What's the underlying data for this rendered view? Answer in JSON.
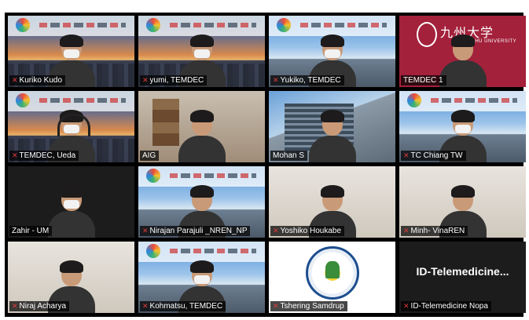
{
  "participants": [
    {
      "name": "Kuriko Kudo",
      "muted": true,
      "bg": "city",
      "banner": true
    },
    {
      "name": "yumi, TEMDEC",
      "muted": true,
      "bg": "city",
      "banner": true
    },
    {
      "name": "Yukiko, TEMDEC",
      "muted": true,
      "bg": "day",
      "banner": true
    },
    {
      "name": "TEMDEC 1",
      "muted": false,
      "bg": "kyushu",
      "banner": false
    },
    {
      "name": "TEMDEC, Ueda",
      "muted": true,
      "bg": "city",
      "banner": true
    },
    {
      "name": "AIG",
      "muted": false,
      "bg": "room",
      "banner": false,
      "active": true
    },
    {
      "name": "Mohan S",
      "muted": false,
      "bg": "bldg",
      "banner": false
    },
    {
      "name": "TC Chiang TW",
      "muted": true,
      "bg": "day",
      "banner": true
    },
    {
      "name": "Zahir - UM",
      "muted": false,
      "bg": "dark",
      "banner": false
    },
    {
      "name": "Nirajan Parajuli _NREN_NP",
      "muted": true,
      "bg": "day",
      "banner": true
    },
    {
      "name": "Yoshiko Houkabe",
      "muted": true,
      "bg": "wall",
      "banner": false
    },
    {
      "name": "Minh- VinaREN",
      "muted": true,
      "bg": "wall",
      "banner": false
    },
    {
      "name": "Niraj Acharya",
      "muted": true,
      "bg": "wall",
      "banner": false
    },
    {
      "name": "Kohmatsu, TEMDEC",
      "muted": true,
      "bg": "day",
      "banner": true
    },
    {
      "name": "Tshering Samdrup",
      "muted": true,
      "bg": "emblem",
      "banner": false
    },
    {
      "name": "ID-Telemedicine Nopa",
      "muted": true,
      "bg": "dark",
      "banner": false,
      "display_name": "ID-Telemedicine..."
    }
  ],
  "kyushu": {
    "title": "九州大学",
    "subtitle": "KYUSHU UNIVERSITY"
  },
  "colors": {
    "active_border": "#d4e84a",
    "mute_icon": "#e03a3a",
    "label_bg": "rgba(0,0,0,0.72)"
  },
  "icons": {
    "muted": "mic-muted-icon"
  }
}
